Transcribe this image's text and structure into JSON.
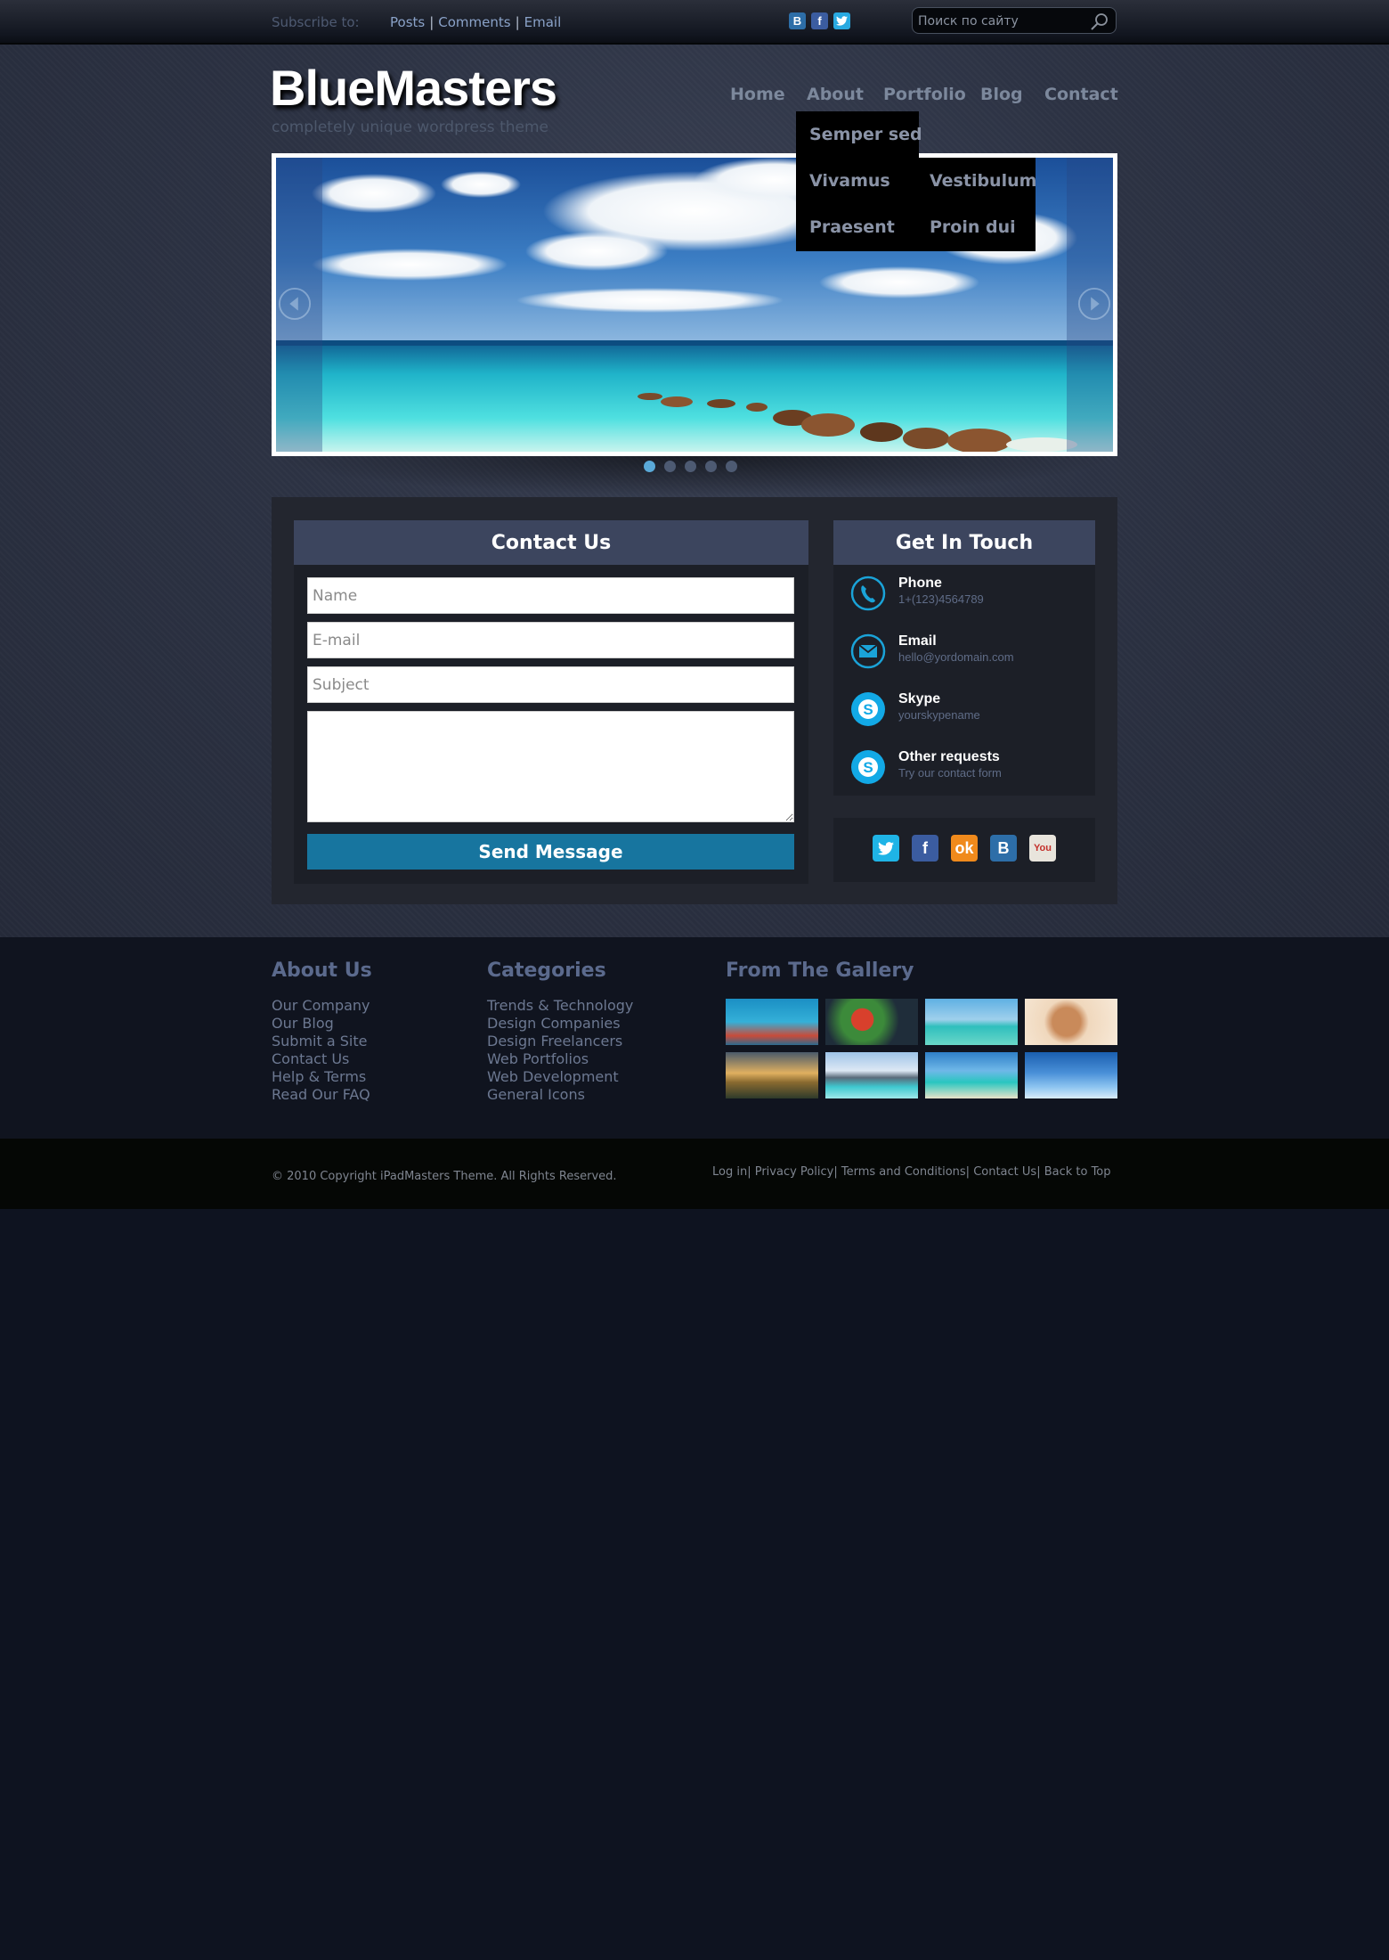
{
  "topbar": {
    "subscribe_label": "Subscribe to:",
    "links": [
      "Posts",
      "Comments",
      "Email"
    ],
    "social_icons": [
      "vk-icon",
      "facebook-icon",
      "twitter-icon"
    ],
    "search_placeholder": "Поиск по сайту"
  },
  "header": {
    "logo": "BlueMasters",
    "tagline": "completely unique wordpress theme"
  },
  "nav": {
    "items": [
      "Home",
      "About",
      "Portfolio",
      "Blog",
      "Contact"
    ],
    "dropdown": {
      "col1": [
        "Semper sed",
        "Vivamus",
        "Praesent"
      ],
      "col2": [
        "Vestibulum",
        "Proin dui"
      ]
    }
  },
  "slider": {
    "slide_count": 5,
    "active_index": 0
  },
  "contact": {
    "title": "Contact Us",
    "name_placeholder": "Name",
    "email_placeholder": "E-mail",
    "subject_placeholder": "Subject",
    "send_label": "Send Message"
  },
  "touch": {
    "title": "Get In Touch",
    "items": [
      {
        "title": "Phone",
        "sub": "1+(123)4564789",
        "icon": "phone-icon"
      },
      {
        "title": "Email",
        "sub": "hello@yordomain.com",
        "icon": "email-icon"
      },
      {
        "title": "Skype",
        "sub": "yourskypename",
        "icon": "skype-icon"
      },
      {
        "title": "Other requests",
        "sub": "Try our contact form",
        "icon": "skype-icon"
      }
    ],
    "social": [
      "twitter-icon",
      "facebook-icon",
      "odnoklassniki-icon",
      "vk-icon",
      "youtube-icon"
    ]
  },
  "footer": {
    "about_title": "About Us",
    "about_links": [
      "Our Company",
      "Our Blog",
      "Submit a Site",
      "Contact Us",
      "Help & Terms",
      "Read Our FAQ"
    ],
    "categories_title": "Categories",
    "categories_links": [
      "Trends & Technology",
      "Design Companies",
      "Design Freelancers",
      "Web Portfolios",
      "Web Development",
      "General Icons"
    ],
    "gallery_title": "From The Gallery",
    "copyright": "© 2010 Copyright iPadMasters Theme. All Rights Reserved.",
    "bottom_links": [
      "Log in",
      "Privacy Policy",
      "Terms and Conditions",
      "Contact Us",
      "Back to Top"
    ]
  },
  "colors": {
    "accent": "#17759f",
    "header_box": "#3c455e",
    "active_dot": "#5aa9d8"
  }
}
